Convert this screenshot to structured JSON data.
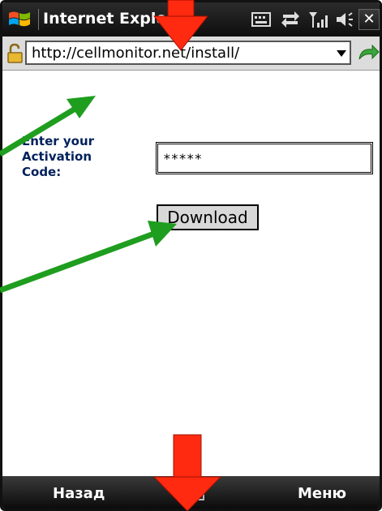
{
  "titlebar": {
    "app_title": "Internet Explorer",
    "close_label": "✕",
    "icons": [
      "windows-logo-icon",
      "keyboard-icon",
      "sync-icon",
      "signal-icon",
      "volume-icon"
    ]
  },
  "addressbar": {
    "url": "http://cellmonitor.net/install/",
    "icons": [
      "lock-icon",
      "dropdown-icon",
      "go-icon"
    ]
  },
  "form": {
    "label_line1": "Enter your",
    "label_line2": "Activation",
    "label_line3": "Code:",
    "code_value": "*****",
    "download_label": "Download"
  },
  "softkeys": {
    "left_label": "Назад",
    "right_label": "Меню"
  },
  "colors": {
    "titlebar_bg": "#111111",
    "label_text": "#00205b",
    "arrow_red": "#ff2a10",
    "arrow_green": "#1f9d1f"
  },
  "annotations": [
    "red-arrow-top",
    "green-arrow-url",
    "green-arrow-download",
    "red-arrow-bottom"
  ]
}
